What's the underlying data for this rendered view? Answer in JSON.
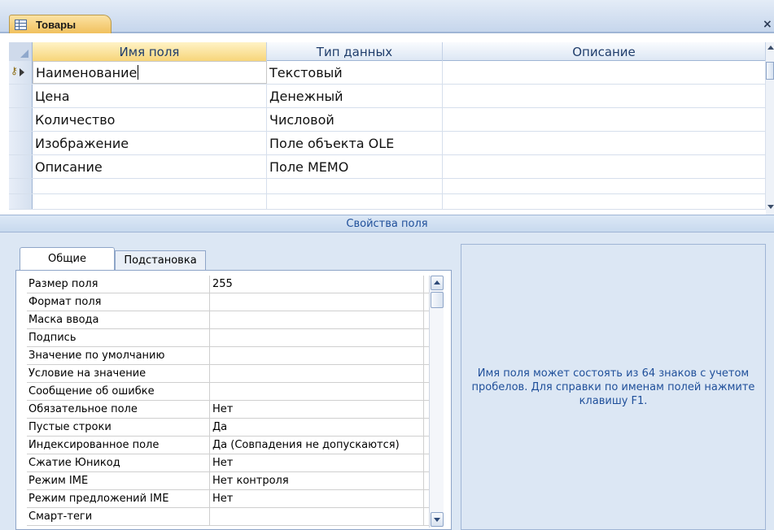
{
  "document_tab": {
    "label": "Товары",
    "icon": "table-icon"
  },
  "close_glyph": "×",
  "grid": {
    "columns": [
      "Имя поля",
      "Тип данных",
      "Описание"
    ],
    "rows": [
      {
        "name": "Наименование",
        "type": "Текстовый",
        "description": ""
      },
      {
        "name": "Цена",
        "type": "Денежный",
        "description": ""
      },
      {
        "name": "Количество",
        "type": "Числовой",
        "description": ""
      },
      {
        "name": "Изображение",
        "type": "Поле объекта OLE",
        "description": ""
      },
      {
        "name": "Описание",
        "type": "Поле MEMO",
        "description": ""
      }
    ]
  },
  "properties_label": "Свойства поля",
  "tabs": {
    "general": "Общие",
    "lookup": "Подстановка"
  },
  "properties": [
    {
      "name": "Размер поля",
      "value": "255"
    },
    {
      "name": "Формат поля",
      "value": ""
    },
    {
      "name": "Маска ввода",
      "value": ""
    },
    {
      "name": "Подпись",
      "value": ""
    },
    {
      "name": "Значение по умолчанию",
      "value": ""
    },
    {
      "name": "Условие на значение",
      "value": ""
    },
    {
      "name": "Сообщение об ошибке",
      "value": ""
    },
    {
      "name": "Обязательное поле",
      "value": "Нет"
    },
    {
      "name": "Пустые строки",
      "value": "Да"
    },
    {
      "name": "Индексированное поле",
      "value": "Да (Совпадения не допускаются)"
    },
    {
      "name": "Сжатие Юникод",
      "value": "Нет"
    },
    {
      "name": "Режим IME",
      "value": "Нет контроля"
    },
    {
      "name": "Режим предложений IME",
      "value": "Нет"
    },
    {
      "name": "Смарт-теги",
      "value": ""
    }
  ],
  "help_text": "Имя поля может состоять из 64 знаков с учетом пробелов.  Для справки по именам полей нажмите клавишу F1."
}
